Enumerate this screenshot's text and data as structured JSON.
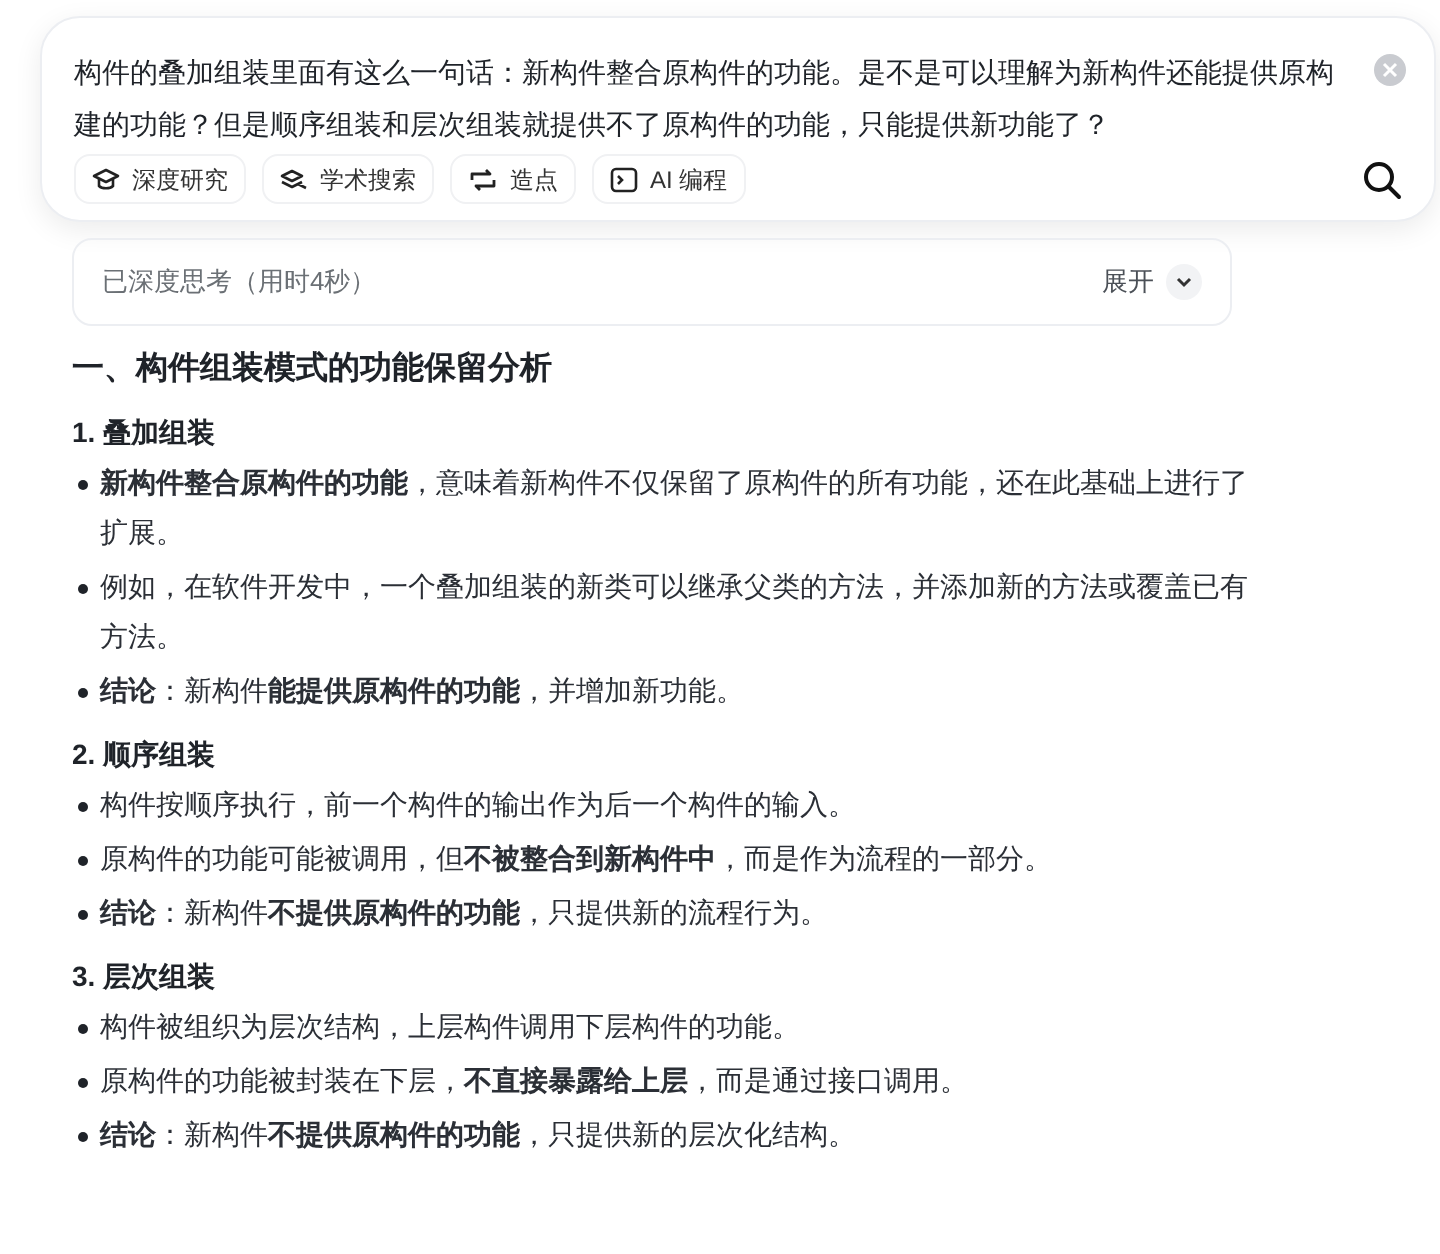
{
  "query": {
    "text": "构件的叠加组装里面有这么一句话：新构件整合原构件的功能。是不是可以理解为新构件还能提供原构建的功能？但是顺序组装和层次组装就提供不了原构件的功能，只能提供新功能了？"
  },
  "tools": [
    {
      "label": "深度研究"
    },
    {
      "label": "学术搜索"
    },
    {
      "label": "造点"
    },
    {
      "label": "AI 编程"
    }
  ],
  "thinking": {
    "label": "已深度思考（用时4秒）",
    "toggle": "展开",
    "expanded": false
  },
  "answer": {
    "heading": "一、构件组装模式的功能保留分析",
    "sections": [
      {
        "title": "1. 叠加组装",
        "bullets": [
          "**新构件整合原构件的功能**，意味着新构件不仅保留了原构件的所有功能，还在此基础上进行了扩展。",
          "例如，在软件开发中，一个叠加组装的新类可以继承父类的方法，并添加新的方法或覆盖已有方法。",
          "**结论**：新构件**能提供原构件的功能**，并增加新功能。"
        ]
      },
      {
        "title": "2. 顺序组装",
        "bullets": [
          "构件按顺序执行，前一个构件的输出作为后一个构件的输入。",
          "原构件的功能可能被调用，但**不被整合到新构件中**，而是作为流程的一部分。",
          "**结论**：新构件**不提供原构件的功能**，只提供新的流程行为。"
        ]
      },
      {
        "title": "3. 层次组装",
        "bullets": [
          "构件被组织为层次结构，上层构件调用下层构件的功能。",
          "原构件的功能被封装在下层，**不直接暴露给上层**，而是通过接口调用。",
          "**结论**：新构件**不提供原构件的功能**，只提供新的层次化结构。"
        ]
      }
    ]
  }
}
